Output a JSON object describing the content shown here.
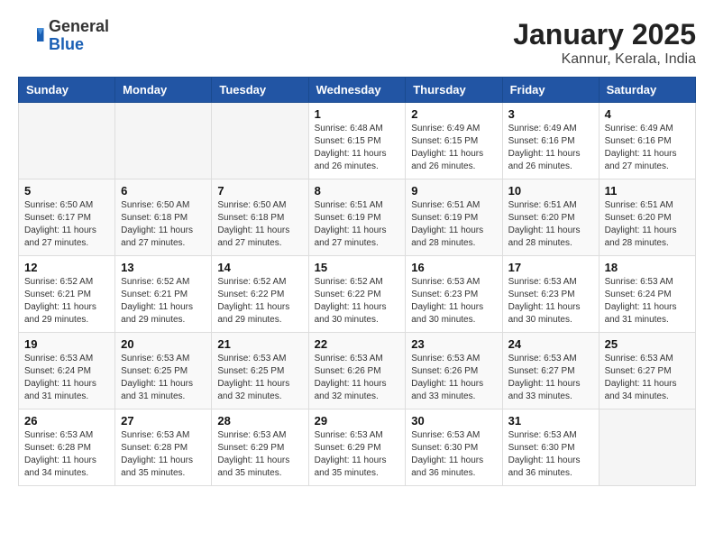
{
  "header": {
    "logo": {
      "general": "General",
      "blue": "Blue"
    },
    "title": "January 2025",
    "location": "Kannur, Kerala, India"
  },
  "weekdays": [
    "Sunday",
    "Monday",
    "Tuesday",
    "Wednesday",
    "Thursday",
    "Friday",
    "Saturday"
  ],
  "weeks": [
    [
      {
        "day": "",
        "info": ""
      },
      {
        "day": "",
        "info": ""
      },
      {
        "day": "",
        "info": ""
      },
      {
        "day": "1",
        "info": "Sunrise: 6:48 AM\nSunset: 6:15 PM\nDaylight: 11 hours\nand 26 minutes."
      },
      {
        "day": "2",
        "info": "Sunrise: 6:49 AM\nSunset: 6:15 PM\nDaylight: 11 hours\nand 26 minutes."
      },
      {
        "day": "3",
        "info": "Sunrise: 6:49 AM\nSunset: 6:16 PM\nDaylight: 11 hours\nand 26 minutes."
      },
      {
        "day": "4",
        "info": "Sunrise: 6:49 AM\nSunset: 6:16 PM\nDaylight: 11 hours\nand 27 minutes."
      }
    ],
    [
      {
        "day": "5",
        "info": "Sunrise: 6:50 AM\nSunset: 6:17 PM\nDaylight: 11 hours\nand 27 minutes."
      },
      {
        "day": "6",
        "info": "Sunrise: 6:50 AM\nSunset: 6:18 PM\nDaylight: 11 hours\nand 27 minutes."
      },
      {
        "day": "7",
        "info": "Sunrise: 6:50 AM\nSunset: 6:18 PM\nDaylight: 11 hours\nand 27 minutes."
      },
      {
        "day": "8",
        "info": "Sunrise: 6:51 AM\nSunset: 6:19 PM\nDaylight: 11 hours\nand 27 minutes."
      },
      {
        "day": "9",
        "info": "Sunrise: 6:51 AM\nSunset: 6:19 PM\nDaylight: 11 hours\nand 28 minutes."
      },
      {
        "day": "10",
        "info": "Sunrise: 6:51 AM\nSunset: 6:20 PM\nDaylight: 11 hours\nand 28 minutes."
      },
      {
        "day": "11",
        "info": "Sunrise: 6:51 AM\nSunset: 6:20 PM\nDaylight: 11 hours\nand 28 minutes."
      }
    ],
    [
      {
        "day": "12",
        "info": "Sunrise: 6:52 AM\nSunset: 6:21 PM\nDaylight: 11 hours\nand 29 minutes."
      },
      {
        "day": "13",
        "info": "Sunrise: 6:52 AM\nSunset: 6:21 PM\nDaylight: 11 hours\nand 29 minutes."
      },
      {
        "day": "14",
        "info": "Sunrise: 6:52 AM\nSunset: 6:22 PM\nDaylight: 11 hours\nand 29 minutes."
      },
      {
        "day": "15",
        "info": "Sunrise: 6:52 AM\nSunset: 6:22 PM\nDaylight: 11 hours\nand 30 minutes."
      },
      {
        "day": "16",
        "info": "Sunrise: 6:53 AM\nSunset: 6:23 PM\nDaylight: 11 hours\nand 30 minutes."
      },
      {
        "day": "17",
        "info": "Sunrise: 6:53 AM\nSunset: 6:23 PM\nDaylight: 11 hours\nand 30 minutes."
      },
      {
        "day": "18",
        "info": "Sunrise: 6:53 AM\nSunset: 6:24 PM\nDaylight: 11 hours\nand 31 minutes."
      }
    ],
    [
      {
        "day": "19",
        "info": "Sunrise: 6:53 AM\nSunset: 6:24 PM\nDaylight: 11 hours\nand 31 minutes."
      },
      {
        "day": "20",
        "info": "Sunrise: 6:53 AM\nSunset: 6:25 PM\nDaylight: 11 hours\nand 31 minutes."
      },
      {
        "day": "21",
        "info": "Sunrise: 6:53 AM\nSunset: 6:25 PM\nDaylight: 11 hours\nand 32 minutes."
      },
      {
        "day": "22",
        "info": "Sunrise: 6:53 AM\nSunset: 6:26 PM\nDaylight: 11 hours\nand 32 minutes."
      },
      {
        "day": "23",
        "info": "Sunrise: 6:53 AM\nSunset: 6:26 PM\nDaylight: 11 hours\nand 33 minutes."
      },
      {
        "day": "24",
        "info": "Sunrise: 6:53 AM\nSunset: 6:27 PM\nDaylight: 11 hours\nand 33 minutes."
      },
      {
        "day": "25",
        "info": "Sunrise: 6:53 AM\nSunset: 6:27 PM\nDaylight: 11 hours\nand 34 minutes."
      }
    ],
    [
      {
        "day": "26",
        "info": "Sunrise: 6:53 AM\nSunset: 6:28 PM\nDaylight: 11 hours\nand 34 minutes."
      },
      {
        "day": "27",
        "info": "Sunrise: 6:53 AM\nSunset: 6:28 PM\nDaylight: 11 hours\nand 35 minutes."
      },
      {
        "day": "28",
        "info": "Sunrise: 6:53 AM\nSunset: 6:29 PM\nDaylight: 11 hours\nand 35 minutes."
      },
      {
        "day": "29",
        "info": "Sunrise: 6:53 AM\nSunset: 6:29 PM\nDaylight: 11 hours\nand 35 minutes."
      },
      {
        "day": "30",
        "info": "Sunrise: 6:53 AM\nSunset: 6:30 PM\nDaylight: 11 hours\nand 36 minutes."
      },
      {
        "day": "31",
        "info": "Sunrise: 6:53 AM\nSunset: 6:30 PM\nDaylight: 11 hours\nand 36 minutes."
      },
      {
        "day": "",
        "info": ""
      }
    ]
  ]
}
